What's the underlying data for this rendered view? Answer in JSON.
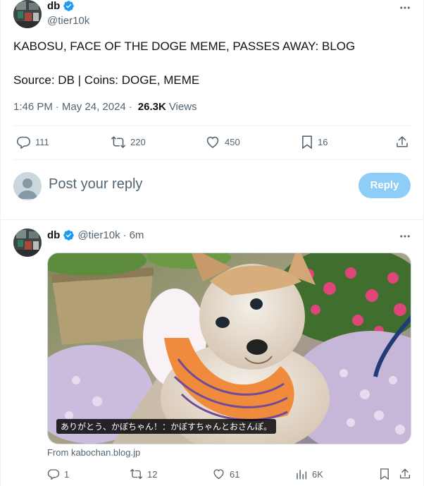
{
  "main_tweet": {
    "author_name": "db",
    "author_handle": "@tier10k",
    "headline": "KABOSU, FACE OF THE DOGE MEME, PASSES AWAY: BLOG",
    "source_line": "Source: DB | Coins: DOGE, MEME",
    "time": "1:46 PM",
    "date": "May 24, 2024",
    "views_count": "26.3K",
    "views_label": "Views",
    "separator": "·",
    "more_icon": "more-horizontal-icon",
    "stats": {
      "replies": "111",
      "retweets": "220",
      "likes": "450",
      "bookmarks": "16"
    }
  },
  "reply_box": {
    "placeholder": "Post your reply",
    "button_label": "Reply"
  },
  "reply_tweet": {
    "author_name": "db",
    "author_handle": "@tier10k",
    "separator": "·",
    "time_ago": "6m",
    "media_caption": "ありがとう、かぼちゃん！：かぼすちゃんとおさんぽ。",
    "media_source": "From kabochan.blog.jp",
    "stats": {
      "replies": "1",
      "retweets": "12",
      "likes": "61",
      "views": "6K"
    }
  },
  "colors": {
    "verified_blue": "#1d9bf0",
    "reply_button_disabled": "#8ecdf8",
    "text_secondary": "#536471",
    "divider": "#eff3f4"
  }
}
